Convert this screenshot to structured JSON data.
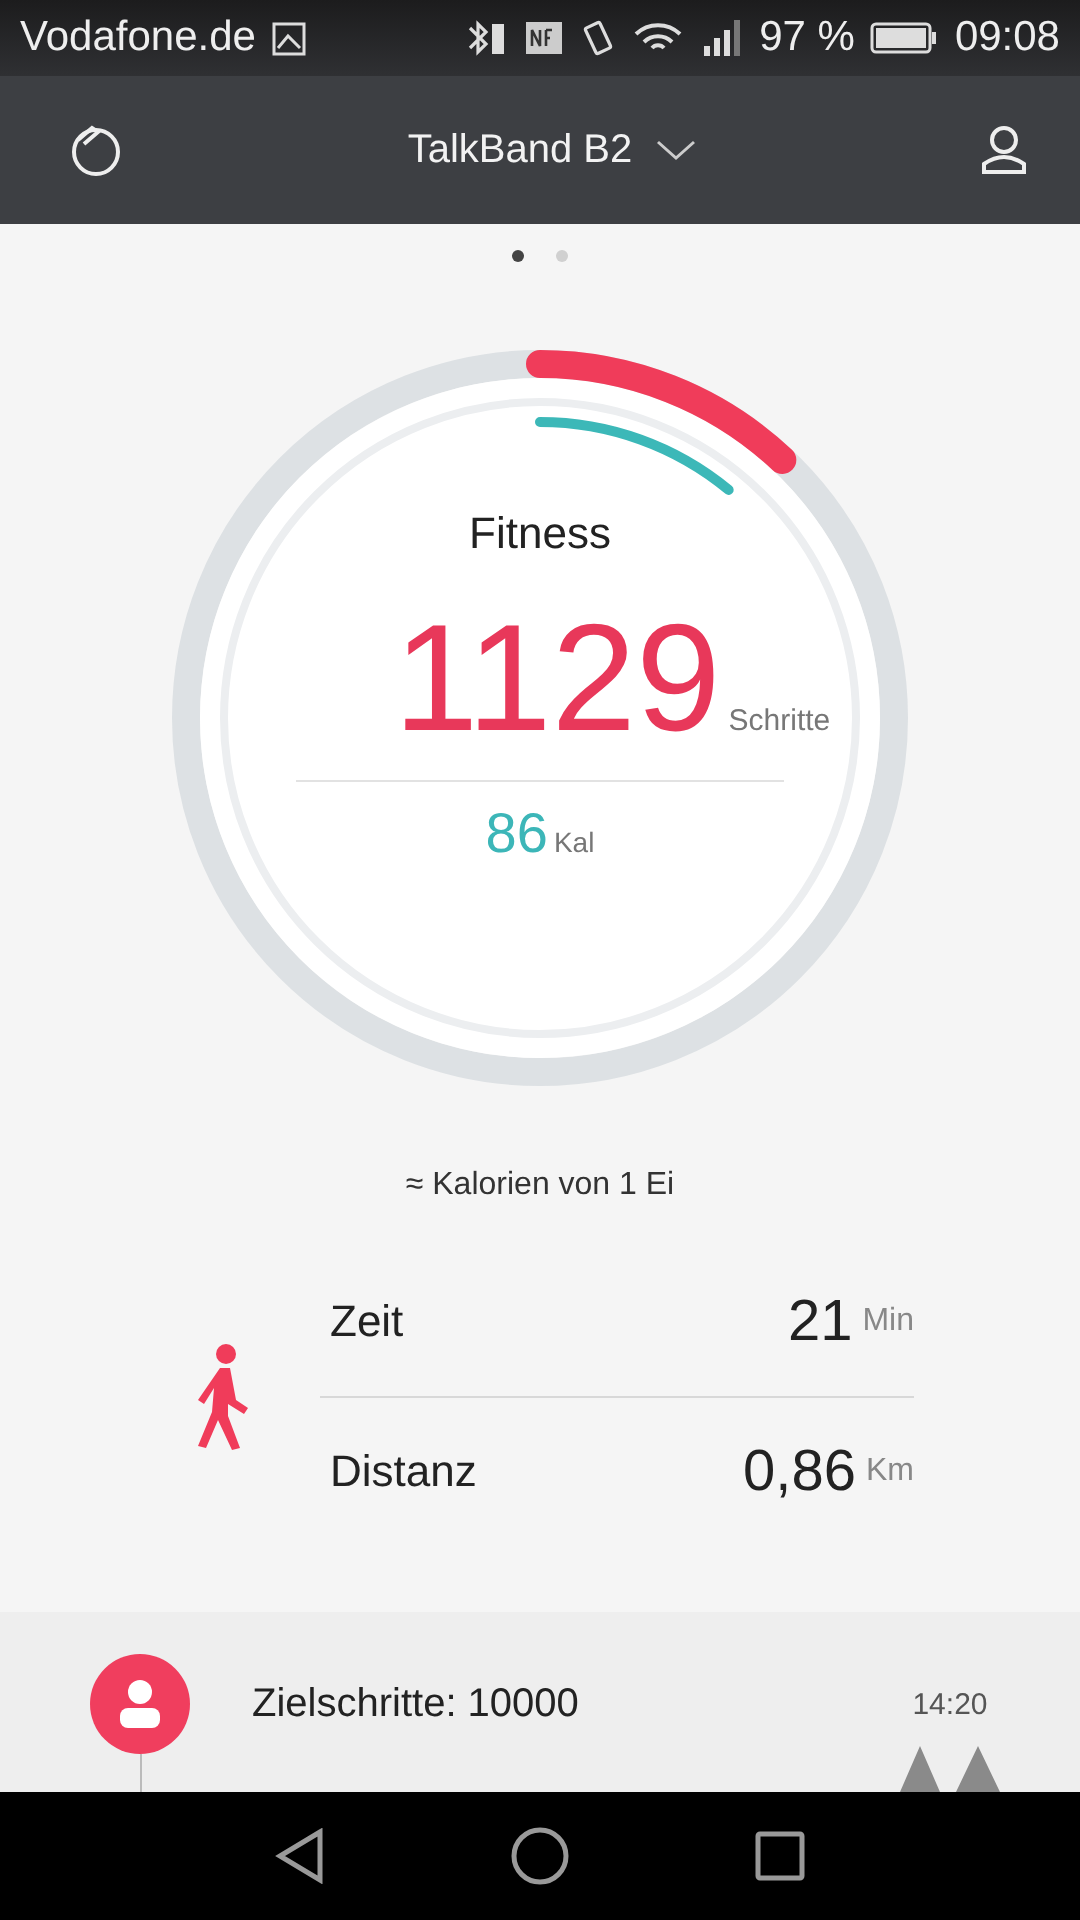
{
  "status_bar": {
    "carrier": "Vodafone.de",
    "battery": "97 %",
    "time": "09:08"
  },
  "app_bar": {
    "title": "TalkBand B2"
  },
  "pager": [
    {
      "selected": true
    },
    {
      "selected": false
    }
  ],
  "ring": {
    "title": "Fitness",
    "steps": "1129",
    "steps_unit": "Schritte",
    "calories": "86",
    "calories_unit": "Kal"
  },
  "hint": "≈ Kalorien von 1 Ei",
  "stats": [
    {
      "label": "Zeit",
      "value": "21",
      "unit": "Min"
    },
    {
      "label": "Distanz",
      "value": "0,86",
      "unit": "Km"
    }
  ],
  "timeline": {
    "text": "Zielschritte: 10000",
    "time": "14:20"
  }
}
